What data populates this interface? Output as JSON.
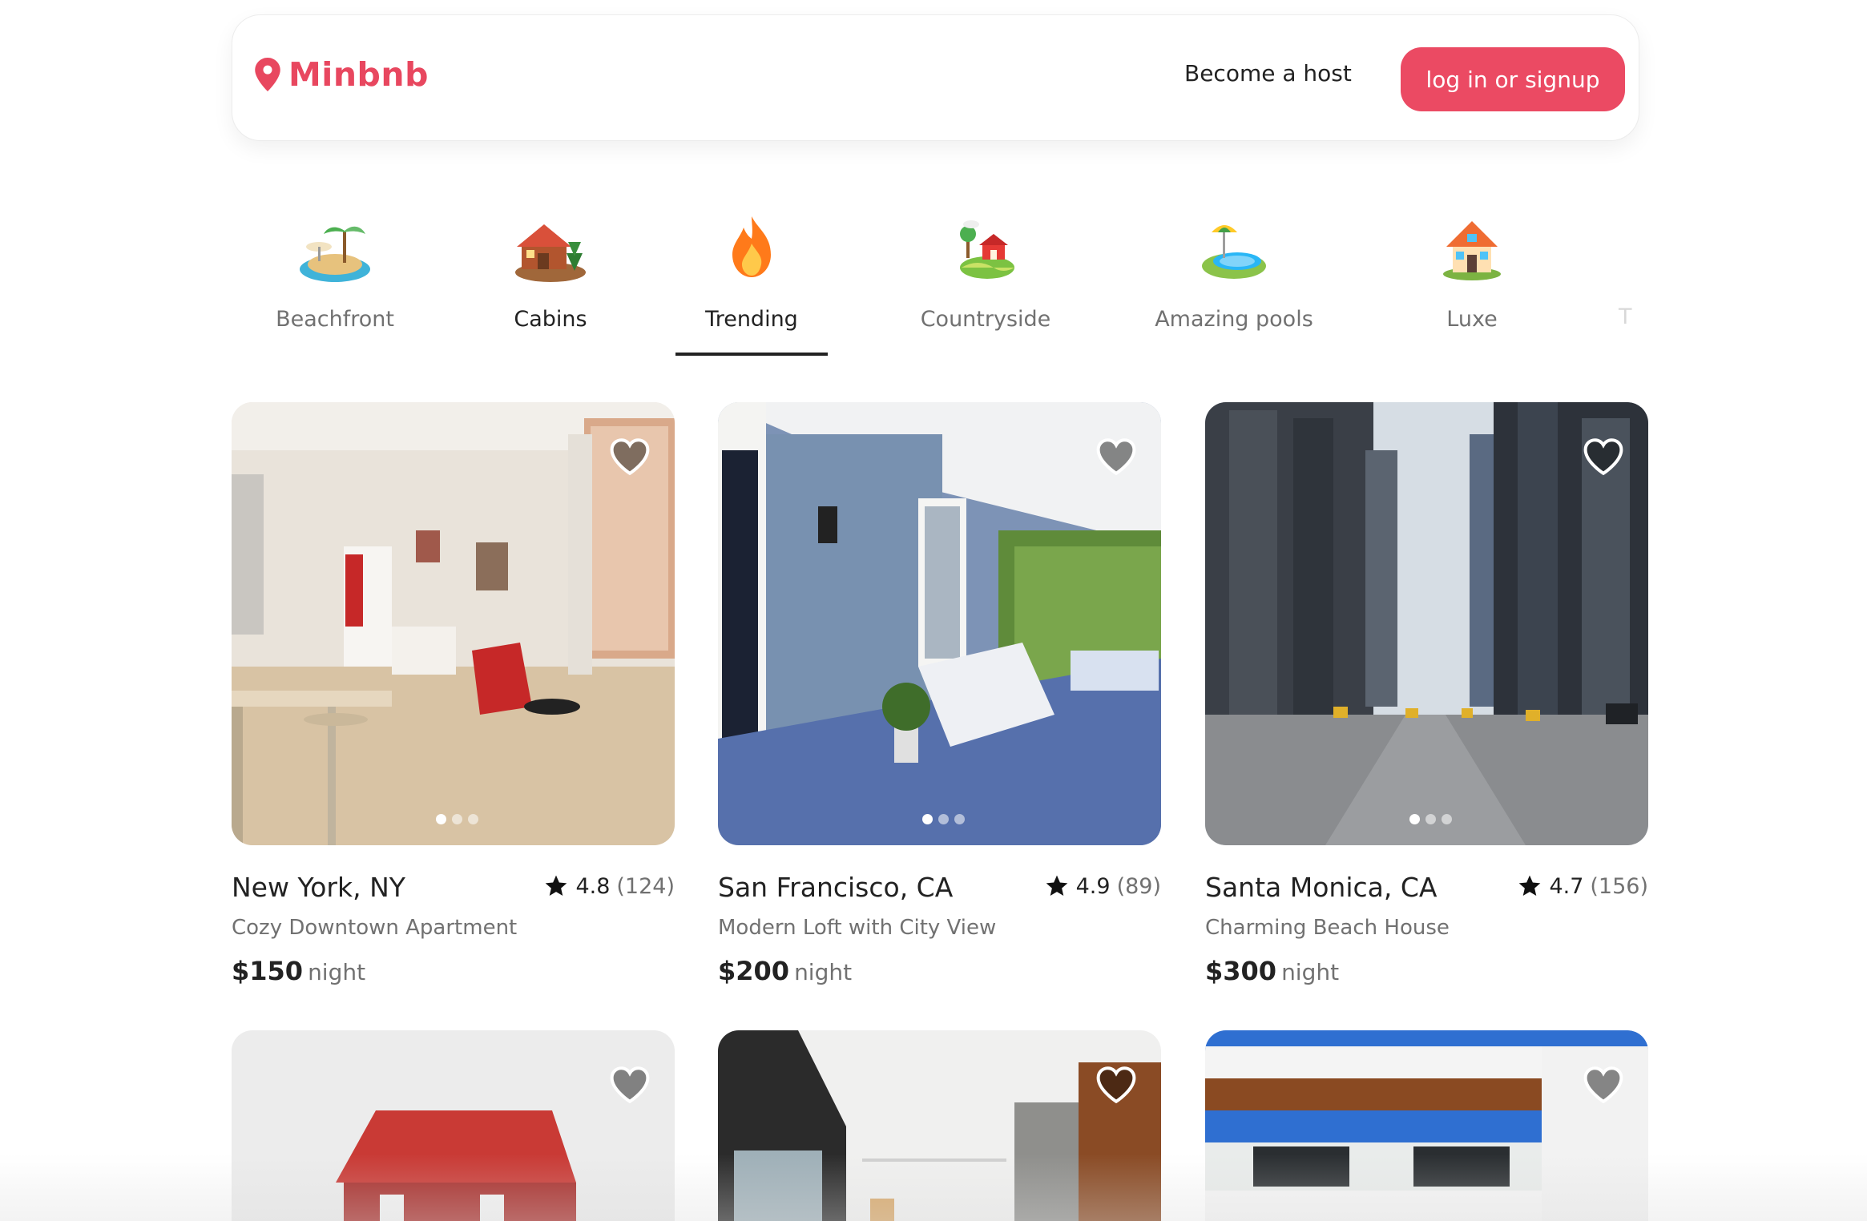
{
  "header": {
    "brand": "Minbnb",
    "host_link": "Become a host",
    "login_button": "log in or signup",
    "brand_color": "#e8475f"
  },
  "categories": [
    {
      "label": "Beachfront",
      "icon": "island-icon",
      "active": false
    },
    {
      "label": "Cabins",
      "icon": "cabin-icon",
      "active": false
    },
    {
      "label": "Trending",
      "icon": "fire-icon",
      "active": true
    },
    {
      "label": "Countryside",
      "icon": "countryside-icon",
      "active": false
    },
    {
      "label": "Amazing pools",
      "icon": "pool-icon",
      "active": false
    },
    {
      "label": "Luxe",
      "icon": "house-icon",
      "active": false
    },
    {
      "label": "T",
      "icon": "",
      "active": false
    }
  ],
  "listings": [
    {
      "city": "New York, NY",
      "rating": "4.8",
      "reviews": "(124)",
      "title": "Cozy Downtown Apartment",
      "price": "$150",
      "unit": "night"
    },
    {
      "city": "San Francisco, CA",
      "rating": "4.9",
      "reviews": "(89)",
      "title": "Modern Loft with City View",
      "price": "$200",
      "unit": "night"
    },
    {
      "city": "Santa Monica, CA",
      "rating": "4.7",
      "reviews": "(156)",
      "title": "Charming Beach House",
      "price": "$300",
      "unit": "night"
    }
  ]
}
